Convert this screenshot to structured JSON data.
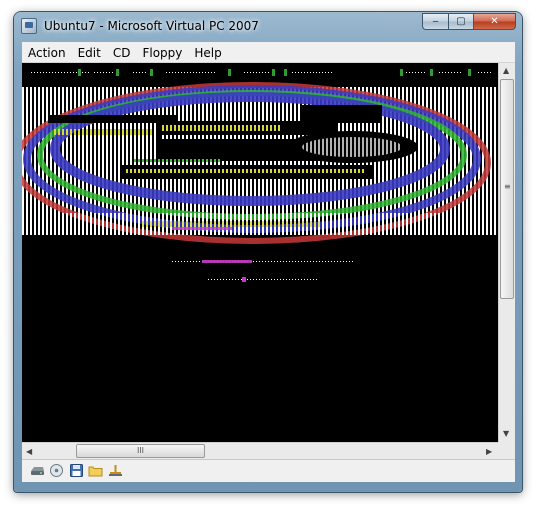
{
  "window": {
    "title": "Ubuntu7 - Microsoft Virtual PC 2007",
    "controls": {
      "minimize": "‒",
      "maximize": "▢",
      "close": "✕"
    }
  },
  "menu": [
    "Action",
    "Edit",
    "CD",
    "Floppy",
    "Help"
  ],
  "scrollbars": {
    "vertical_grip": "≡",
    "horizontal_grip": "III",
    "up_arrow": "▲",
    "down_arrow": "▼",
    "left_arrow": "◀",
    "right_arrow": "▶"
  },
  "status_icons": [
    "hard-disk-icon",
    "cd-drive-icon",
    "floppy-disk-icon",
    "shared-folder-icon",
    "network-icon"
  ],
  "colors": {
    "screen_background": "#000000",
    "frame": "#7fa3c0",
    "close_button": "#c24a2a"
  }
}
